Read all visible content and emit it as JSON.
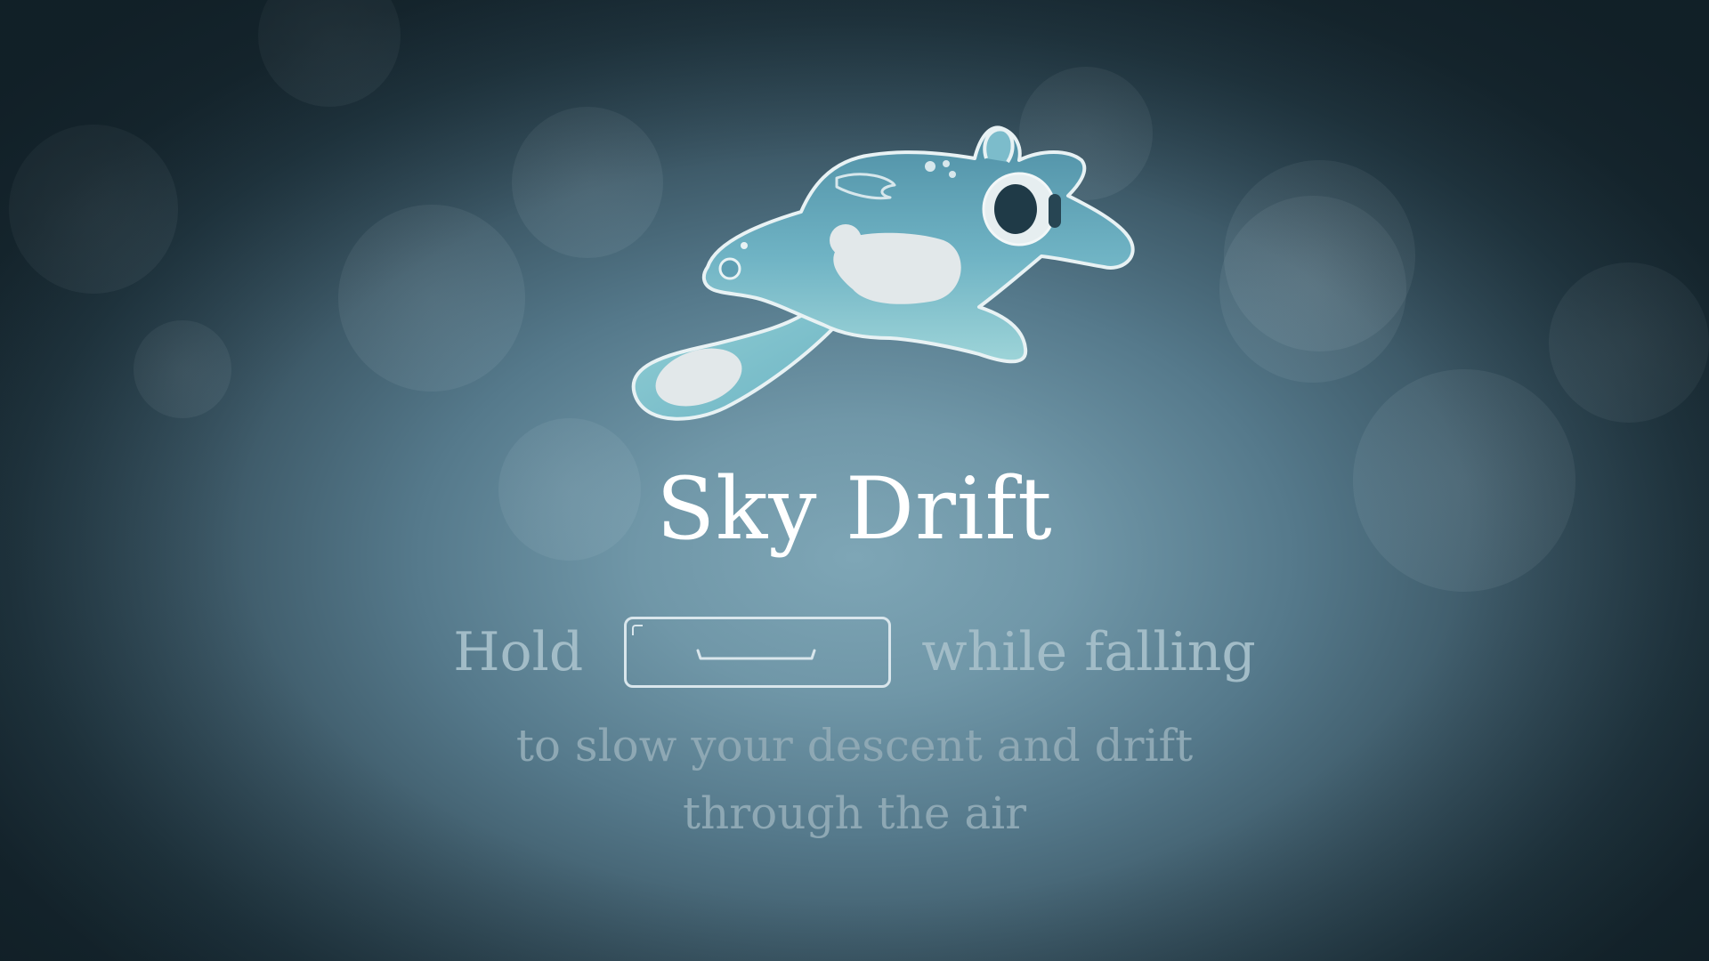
{
  "tutorial": {
    "title": "Sky Drift",
    "instruction": {
      "before_key": "Hold",
      "key_icon": "spacebar-icon",
      "after_key": "while falling"
    },
    "description_lines": [
      "to slow your descent and drift",
      "through the air"
    ]
  },
  "colors": {
    "title": "#ffffff",
    "instruction_text": "#a2bcc7",
    "description_text": "#8ea8b4",
    "key_outline": "#d9e6ec",
    "creature_body": "#6fb3c4",
    "creature_spots": "#e2e8ea"
  },
  "icons": [
    "flying-squirrel-creature-icon",
    "spacebar-icon"
  ]
}
